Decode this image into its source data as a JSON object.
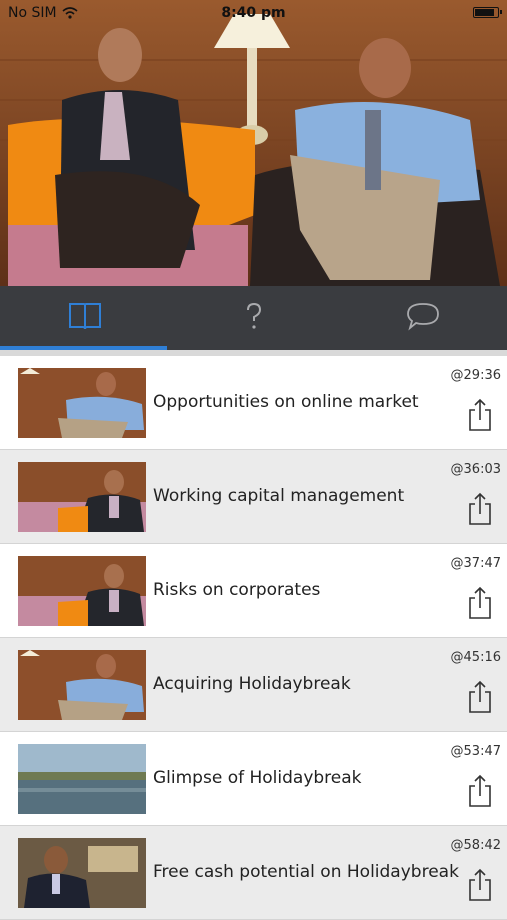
{
  "status_bar": {
    "carrier": "No SIM",
    "time": "8:40 pm",
    "battery_level": 0.9
  },
  "tabs": [
    {
      "name": "chapters",
      "icon": "book-icon",
      "active": true
    },
    {
      "name": "questions",
      "icon": "question-icon",
      "active": false
    },
    {
      "name": "comments",
      "icon": "speech-bubble-icon",
      "active": false
    }
  ],
  "colors": {
    "accent": "#2f7fd6",
    "tabbar": "#3a3c40",
    "row_alt": "#ebebeb"
  },
  "chapters": [
    {
      "title": "Opportunities on online market",
      "timestamp": "@29:36",
      "thumb": "two-men-blue-shirt"
    },
    {
      "title": "Working capital management",
      "timestamp": "@36:03",
      "thumb": "man-dark-suit"
    },
    {
      "title": "Risks on corporates",
      "timestamp": "@37:47",
      "thumb": "man-dark-suit"
    },
    {
      "title": "Acquiring Holidaybreak",
      "timestamp": "@45:16",
      "thumb": "two-men-blue-shirt"
    },
    {
      "title": "Glimpse of Holidaybreak",
      "timestamp": "@53:47",
      "thumb": "lake-landscape"
    },
    {
      "title": "Free cash potential on Holidaybreak",
      "timestamp": "@58:42",
      "thumb": "man-office"
    }
  ]
}
